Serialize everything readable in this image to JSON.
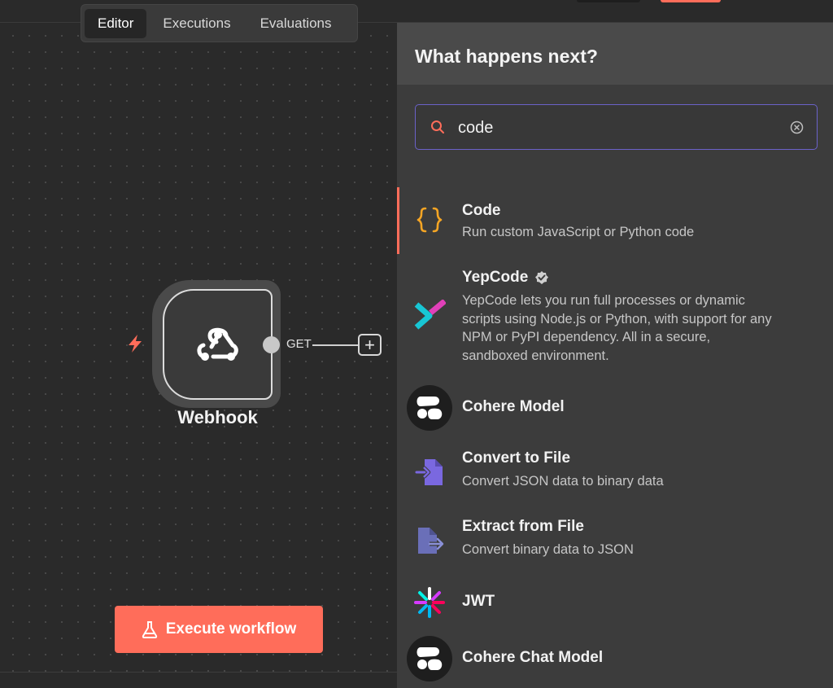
{
  "tabs": [
    {
      "label": "Editor",
      "active": true
    },
    {
      "label": "Executions",
      "active": false
    },
    {
      "label": "Evaluations",
      "active": false
    }
  ],
  "node": {
    "label": "Webhook",
    "icon": "webhook-icon",
    "output_label": "GET",
    "trigger_icon": "lightning-icon"
  },
  "execute_button": {
    "label": "Execute workflow",
    "icon": "flask-icon"
  },
  "panel": {
    "title": "What happens next?",
    "search": {
      "value": "code",
      "placeholder": ""
    },
    "items": [
      {
        "title": "Code",
        "description": "Run custom JavaScript or Python code",
        "icon": "code-braces-icon"
      },
      {
        "title": "YepCode",
        "description": "YepCode lets you run full processes or dynamic scripts using Node.js or Python, with support for any NPM or PyPI dependency. All in a secure, sandboxed environment.",
        "icon": "yepcode-icon",
        "verified": true
      },
      {
        "title": "Cohere Model",
        "description": "",
        "icon": "cohere-icon"
      },
      {
        "title": "Convert to File",
        "description": "Convert JSON data to binary data",
        "icon": "convert-to-file-icon"
      },
      {
        "title": "Extract from File",
        "description": "Convert binary data to JSON",
        "icon": "extract-from-file-icon"
      },
      {
        "title": "JWT",
        "description": "",
        "icon": "jwt-icon"
      },
      {
        "title": "Cohere Chat Model",
        "description": "",
        "icon": "cohere-icon"
      }
    ]
  },
  "colors": {
    "accent": "#ff6d5a",
    "focus": "#6b62c9",
    "code_icon": "#f5a524",
    "file_icon": "#7a68e0"
  }
}
